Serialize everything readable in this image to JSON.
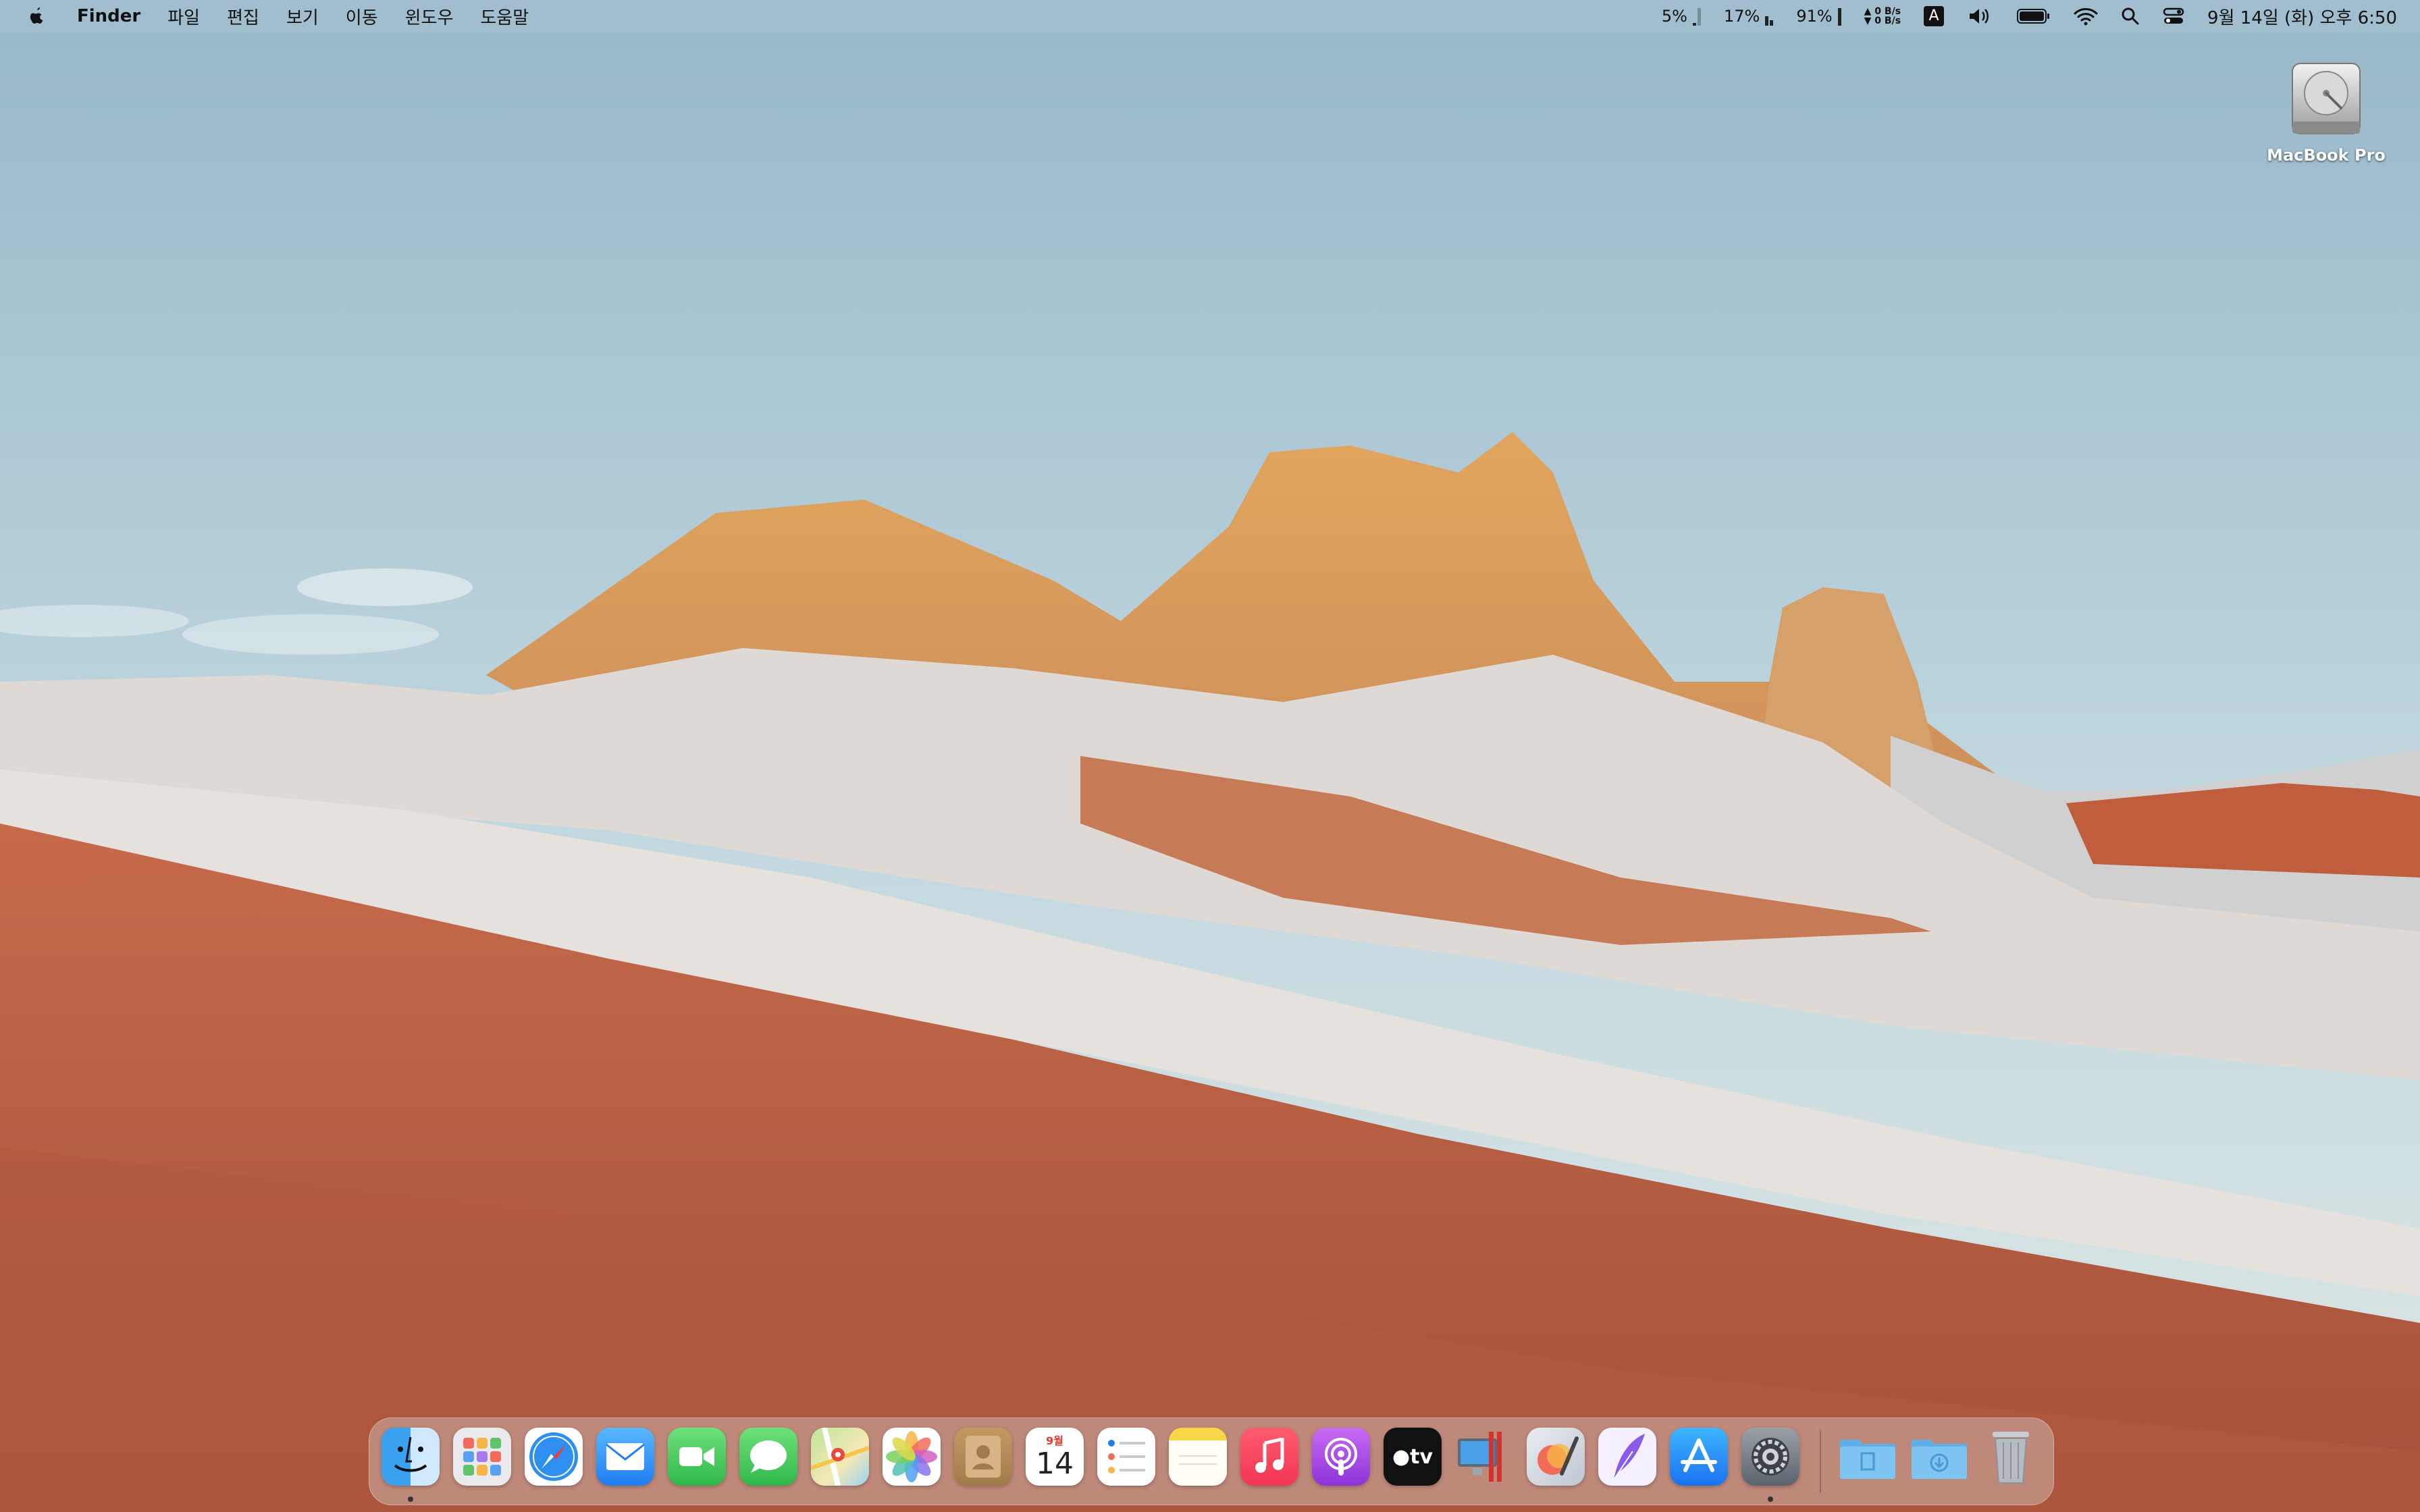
{
  "menubar": {
    "app_name": "Finder",
    "menus": [
      "파일",
      "편집",
      "보기",
      "이동",
      "윈도우",
      "도움말"
    ],
    "stats": {
      "cpu": "5%",
      "memory": "17%",
      "disk": "91%",
      "net_up": "0 B/s",
      "net_down": "0 B/s"
    },
    "input_source": "A",
    "clock": "9월 14일 (화) 오후 6:50"
  },
  "desktop": {
    "drive_label": "MacBook Pro"
  },
  "dock": {
    "calendar_month": "9월",
    "calendar_day": "14",
    "tv_label": "tv",
    "apps": [
      "finder",
      "launchpad",
      "safari",
      "mail",
      "facetime",
      "messages",
      "maps",
      "photos",
      "contacts",
      "calendar",
      "reminders",
      "notes",
      "music",
      "podcasts",
      "tv",
      "parallels",
      "pixelmator",
      "quill",
      "app-store",
      "system-preferences",
      "documents-folder",
      "downloads-folder",
      "trash"
    ]
  }
}
